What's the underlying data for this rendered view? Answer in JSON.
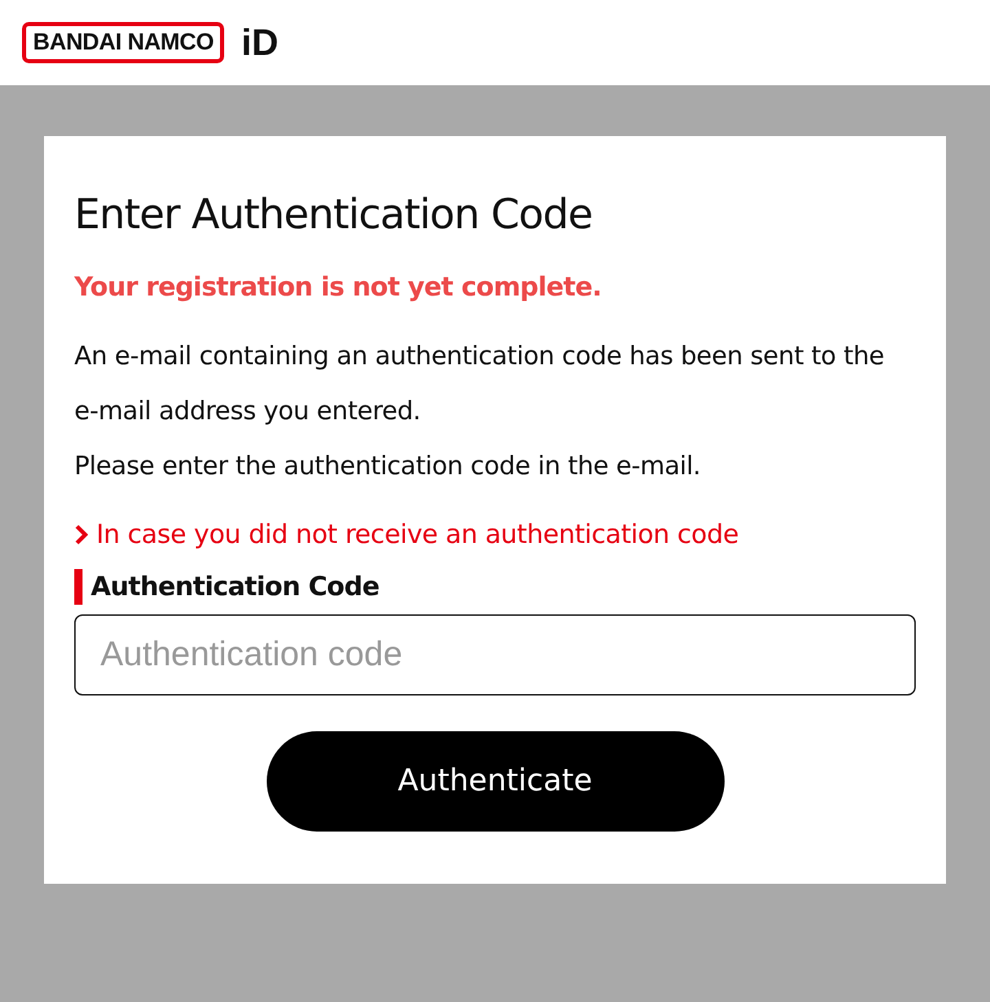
{
  "header": {
    "logo": "BANDAI NAMCO",
    "logo_suffix": "iD"
  },
  "card": {
    "title": "Enter Authentication Code",
    "alert": "Your registration is not yet complete.",
    "paragraphs": [
      "An e-mail containing an authentication code has been sent to the e-mail address you entered.",
      "Please enter the authentication code in the e-mail."
    ],
    "help_link": "In case you did not receive an authentication code",
    "field": {
      "label": "Authentication Code",
      "placeholder": "Authentication code"
    },
    "button": "Authenticate"
  }
}
